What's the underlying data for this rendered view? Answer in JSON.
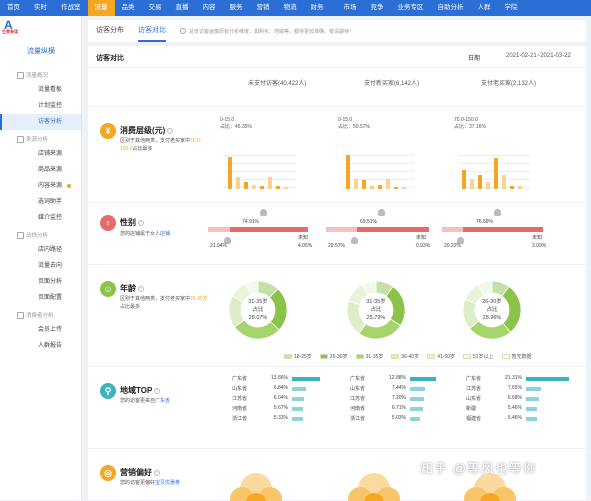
{
  "topnav": {
    "items": [
      {
        "label": "首页",
        "active": false,
        "dot": false
      },
      {
        "label": "实时",
        "active": false,
        "dot": false
      },
      {
        "label": "作战室",
        "active": false,
        "dot": true
      },
      {
        "label": "流量",
        "active": true,
        "dot": false
      },
      {
        "label": "品类",
        "active": false,
        "dot": false
      },
      {
        "label": "交易",
        "active": false,
        "dot": false
      },
      {
        "label": "直播",
        "active": false,
        "dot": false
      },
      {
        "label": "内容",
        "active": false,
        "dot": false
      },
      {
        "label": "服务",
        "active": false,
        "dot": true
      },
      {
        "label": "营销",
        "active": false,
        "dot": true
      },
      {
        "label": "物流",
        "active": false,
        "dot": false
      },
      {
        "label": "财务",
        "active": false,
        "dot": false
      },
      {
        "label": "市场",
        "active": false,
        "dot": false
      },
      {
        "label": "竞争",
        "active": false,
        "dot": false
      },
      {
        "label": "业务专区",
        "active": false,
        "dot": false
      },
      {
        "label": "自助分析",
        "active": false,
        "dot": false
      },
      {
        "label": "人群",
        "active": false,
        "dot": false
      },
      {
        "label": "学院",
        "active": false,
        "dot": false
      }
    ]
  },
  "sidebar": {
    "logo_letter": "A",
    "logo_text": "生意参谋",
    "title": "流量纵横",
    "groups": [
      {
        "label": "流量概况",
        "items": [
          {
            "label": "流量看板",
            "active": false,
            "dot": false
          },
          {
            "label": "计划监控",
            "active": false,
            "dot": false
          },
          {
            "label": "访客分析",
            "active": true,
            "dot": false
          }
        ]
      },
      {
        "label": "来源分析",
        "items": [
          {
            "label": "店铺来源",
            "active": false,
            "dot": false
          },
          {
            "label": "商品来源",
            "active": false,
            "dot": false
          },
          {
            "label": "内容来源",
            "active": false,
            "dot": true
          },
          {
            "label": "选词助手",
            "active": false,
            "dot": false
          },
          {
            "label": "媒介监控",
            "active": false,
            "dot": false
          }
        ]
      },
      {
        "label": "动线分析",
        "items": [
          {
            "label": "店内路径",
            "active": false,
            "dot": false
          },
          {
            "label": "流量去向",
            "active": false,
            "dot": false
          },
          {
            "label": "页面分析",
            "active": false,
            "dot": false
          },
          {
            "label": "页面配置",
            "active": false,
            "dot": false
          }
        ]
      },
      {
        "label": "消费者分析",
        "items": [
          {
            "label": "会员上传",
            "active": false,
            "dot": false
          },
          {
            "label": "人群报告",
            "active": false,
            "dot": false
          }
        ]
      }
    ]
  },
  "tabs": [
    {
      "label": "访客分布",
      "active": false
    },
    {
      "label": "访客对比",
      "active": true
    }
  ],
  "notice": "总览访客画像原有分析维度，如购买、地域等，都将更加准确，敬请期待！",
  "panel": {
    "title": "访客对比",
    "period_label": "日期",
    "date_range": "2021-02-21~2021-03-22"
  },
  "columns": [
    {
      "label": "未支付访客(40,422人)"
    },
    {
      "label": "支付新买家(6,142人)"
    },
    {
      "label": "支付老买家(2,132人)"
    }
  ],
  "colors": {
    "primary": "#2b6fd6",
    "accent": "#f5a623",
    "green": "#8bc34a",
    "teal": "#3cb4bd",
    "red": "#e36b6b"
  },
  "sections": {
    "consumption": {
      "icon": "yen-icon",
      "title": "消费层级(元)",
      "desc_pre": "区别于其他两类，支付老买家中",
      "desc_hl": "70.0-150.0",
      "desc_post": "占比最多",
      "charts": [
        {
          "range": "0-15.0",
          "share_label": "占比：",
          "share": "45.35%",
          "bars": [
            0.95,
            0.35,
            0.2,
            0.12,
            0.1,
            0.35,
            0.08,
            0.05
          ]
        },
        {
          "range": "0-15.0",
          "share_label": "占比：",
          "share": "50.57%",
          "bars": [
            1.0,
            0.3,
            0.25,
            0.1,
            0.12,
            0.3,
            0.06,
            0.05
          ]
        },
        {
          "range": "70.0-150.0",
          "share_label": "占比：",
          "share": "37.16%",
          "bars": [
            0.55,
            0.3,
            0.4,
            0.2,
            0.9,
            0.4,
            0.1,
            0.08
          ]
        }
      ]
    },
    "gender": {
      "icon": "gender-icon",
      "title": "性别",
      "desc_pre": "您的店铺属于",
      "desc_hl": "女人店铺",
      "labels": {
        "unknown": "未知"
      },
      "charts": [
        {
          "female": "74.91%",
          "male": "21.04%",
          "unknown": "4.05%",
          "female_v": 0.7491,
          "male_v": 0.2104
        },
        {
          "female": "69.51%",
          "male": "29.57%",
          "unknown": "0.93%",
          "female_v": 0.6951,
          "male_v": 0.2957
        },
        {
          "female": "76.69%",
          "male": "20.22%",
          "unknown": "3.09%",
          "female_v": 0.7669,
          "male_v": 0.2022
        }
      ]
    },
    "age": {
      "icon": "age-icon",
      "title": "年龄",
      "desc_pre": "区别于其他两类，支付老买家中",
      "desc_hl": "26-30岁",
      "desc_post": "占比最多",
      "charts": [
        {
          "range": "31-35岁",
          "share_label": "占比",
          "share": "28.07%",
          "slices": [
            0.12,
            0.25,
            0.28,
            0.18,
            0.1,
            0.07
          ]
        },
        {
          "range": "31-35岁",
          "share_label": "占比",
          "share": "25.79%",
          "slices": [
            0.1,
            0.24,
            0.26,
            0.2,
            0.12,
            0.08
          ]
        },
        {
          "range": "26-30岁",
          "share_label": "占比",
          "share": "28.96%",
          "slices": [
            0.1,
            0.29,
            0.25,
            0.17,
            0.11,
            0.08
          ]
        }
      ],
      "legend": [
        {
          "label": "18-25岁",
          "color": "#c5e1a5"
        },
        {
          "label": "26-30岁",
          "color": "#8bc34a"
        },
        {
          "label": "31-35岁",
          "color": "#a5d46b"
        },
        {
          "label": "36-40岁",
          "color": "#dcedc8"
        },
        {
          "label": "41-50岁",
          "color": "#e8f3d9"
        },
        {
          "label": "51岁以上",
          "color": "#f1f8e9"
        },
        {
          "label": "暂无数据",
          "color": "#ffffff"
        }
      ]
    },
    "region": {
      "icon": "location-icon",
      "title": "地域TOP",
      "desc_pre": "您的访客更来自",
      "desc_hl": "广东省",
      "charts": [
        {
          "rows": [
            {
              "name": "广东省",
              "value": "13.86%",
              "v": 13.86
            },
            {
              "name": "山东省",
              "value": "6.84%",
              "v": 6.84
            },
            {
              "name": "江苏省",
              "value": "6.04%",
              "v": 6.04
            },
            {
              "name": "河南省",
              "value": "5.67%",
              "v": 5.67
            },
            {
              "name": "浙江省",
              "value": "5.33%",
              "v": 5.33
            }
          ]
        },
        {
          "rows": [
            {
              "name": "广东省",
              "value": "12.88%",
              "v": 12.88
            },
            {
              "name": "山东省",
              "value": "7.44%",
              "v": 7.44
            },
            {
              "name": "江苏省",
              "value": "7.20%",
              "v": 7.2
            },
            {
              "name": "河南省",
              "value": "6.71%",
              "v": 6.71
            },
            {
              "name": "浙江省",
              "value": "5.03%",
              "v": 5.03
            }
          ]
        },
        {
          "rows": [
            {
              "name": "广东省",
              "value": "21.31%",
              "v": 21.31
            },
            {
              "name": "江苏省",
              "value": "7.65%",
              "v": 7.65
            },
            {
              "name": "山东省",
              "value": "6.68%",
              "v": 6.68
            },
            {
              "name": "新疆",
              "value": "5.46%",
              "v": 5.46
            },
            {
              "name": "福建省",
              "value": "5.46%",
              "v": 5.46
            }
          ]
        }
      ]
    },
    "marketing": {
      "icon": "target-icon",
      "title": "营销偏好",
      "desc_pre": "您的访客更偏好",
      "desc_hl": "宝贝优惠券"
    }
  },
  "watermark": "知乎 @等风也等你"
}
